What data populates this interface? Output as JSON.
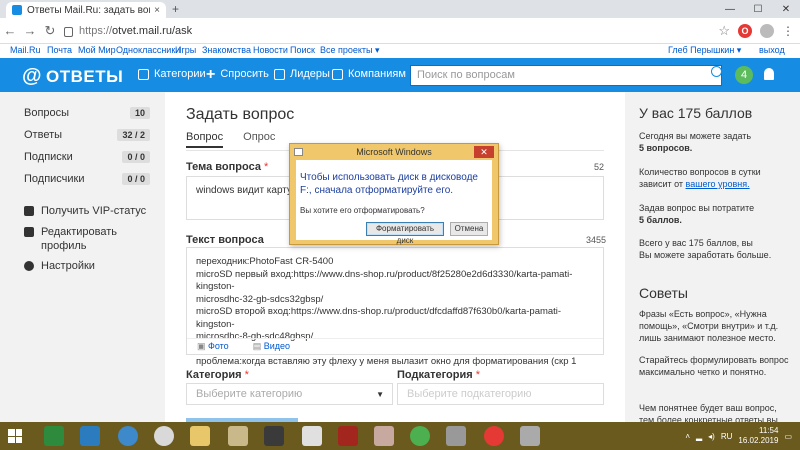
{
  "browser": {
    "tab_title": "Ответы Mail.Ru: задать вопрос",
    "tab_close": "×",
    "new_tab": "+",
    "url_scheme": "https://",
    "url_rest": "otvet.mail.ru/ask",
    "ext_label": "О",
    "window_controls": [
      "—",
      "☐",
      "✕"
    ]
  },
  "portal": {
    "links": [
      "Mail.Ru",
      "Почта",
      "Мой Мир",
      "Одноклассники",
      "Игры",
      "Знакомства",
      "Новости",
      "Поиск",
      "Все проекты ▾"
    ],
    "user": "Глеб Перышкин ▾",
    "logout": "выход"
  },
  "header": {
    "logo_at": "@",
    "logo_text": "ОТВЕТЫ",
    "nav": [
      "Категории",
      "Спросить",
      "Лидеры",
      "Компаниям"
    ],
    "plus": "+",
    "search_placeholder": "Поиск по вопросам",
    "notif_count": "4",
    "accent": "#168de2"
  },
  "sidebar": {
    "items": [
      {
        "label": "Вопросы",
        "count": "10"
      },
      {
        "label": "Ответы",
        "count": "32 / 2"
      },
      {
        "label": "Подписки",
        "count": "0 / 0"
      },
      {
        "label": "Подписчики",
        "count": "0 / 0"
      }
    ],
    "links": [
      "Получить VIP-статус",
      "Редактировать профиль",
      "Настройки"
    ]
  },
  "main": {
    "title": "Задать вопрос",
    "tabs": [
      "Вопрос",
      "Опрос"
    ],
    "topic_label": "Тема вопроса",
    "required_mark": "*",
    "topic_counter": "52",
    "topic_value": "windows видит карту па",
    "text_label": "Текст вопроса",
    "text_counter": "3455",
    "text_lines": [
      "переходник:PhotoFast CR-5400",
      "microSD первый вход:https://www.dns-shop.ru/product/8f25280e2d6d3330/karta-pamati-kingston-",
      "microsdhc-32-gb-sdcs32gbsp/",
      "microSD второй вход:https://www.dns-shop.ru/product/dfcdaffd87f630b0/karta-pamati-kingston-",
      "microsdhc-8-gb-sdc48gbsp/",
      "",
      "проблема:когда вставляю эту флеху у меня вылазит окно для форматирования (скр 1"
    ],
    "attach_photo": "Фото",
    "attach_video": "Видео",
    "category_label": "Категория",
    "category_placeholder": "Выберите категорию",
    "subcategory_label": "Подкатегория",
    "subcategory_placeholder": "Выберите подкатегорию"
  },
  "right": {
    "points_heading": "У вас 175 баллов",
    "p1": "Сегодня вы можете задать",
    "p1b": "5 вопросов.",
    "p2": "Количество вопросов в сутки зависит от",
    "p2link": "вашего уровня.",
    "p3": "Задав вопрос вы потратите",
    "p3b": "5 баллов.",
    "p4": "Вы можете заработать больше.",
    "p4pre": "Всего у вас 175 баллов, вы",
    "tips_heading": "Советы",
    "t1": "Фразы «Есть вопрос», «Нужна помощь», «Смотри внутри» и т.д. лишь занимают полезное место.",
    "t2": "Старайтесь формулировать вопрос максимально четко и понятно.",
    "t3": "Чем понятнее будет ваш вопрос, тем более конкретные ответы вы"
  },
  "dialog": {
    "title": "Microsoft Windows",
    "message": "Чтобы использовать диск в дисководе F:, сначала отформатируйте его.",
    "question": "Вы хотите его отформатировать?",
    "format_button": "Форматировать диск",
    "cancel_button": "Отмена",
    "close": "✕"
  },
  "taskbar": {
    "lang": "RU",
    "time": "11:54",
    "date": "16.02.2019",
    "bar_color": "#6b5a1e"
  }
}
